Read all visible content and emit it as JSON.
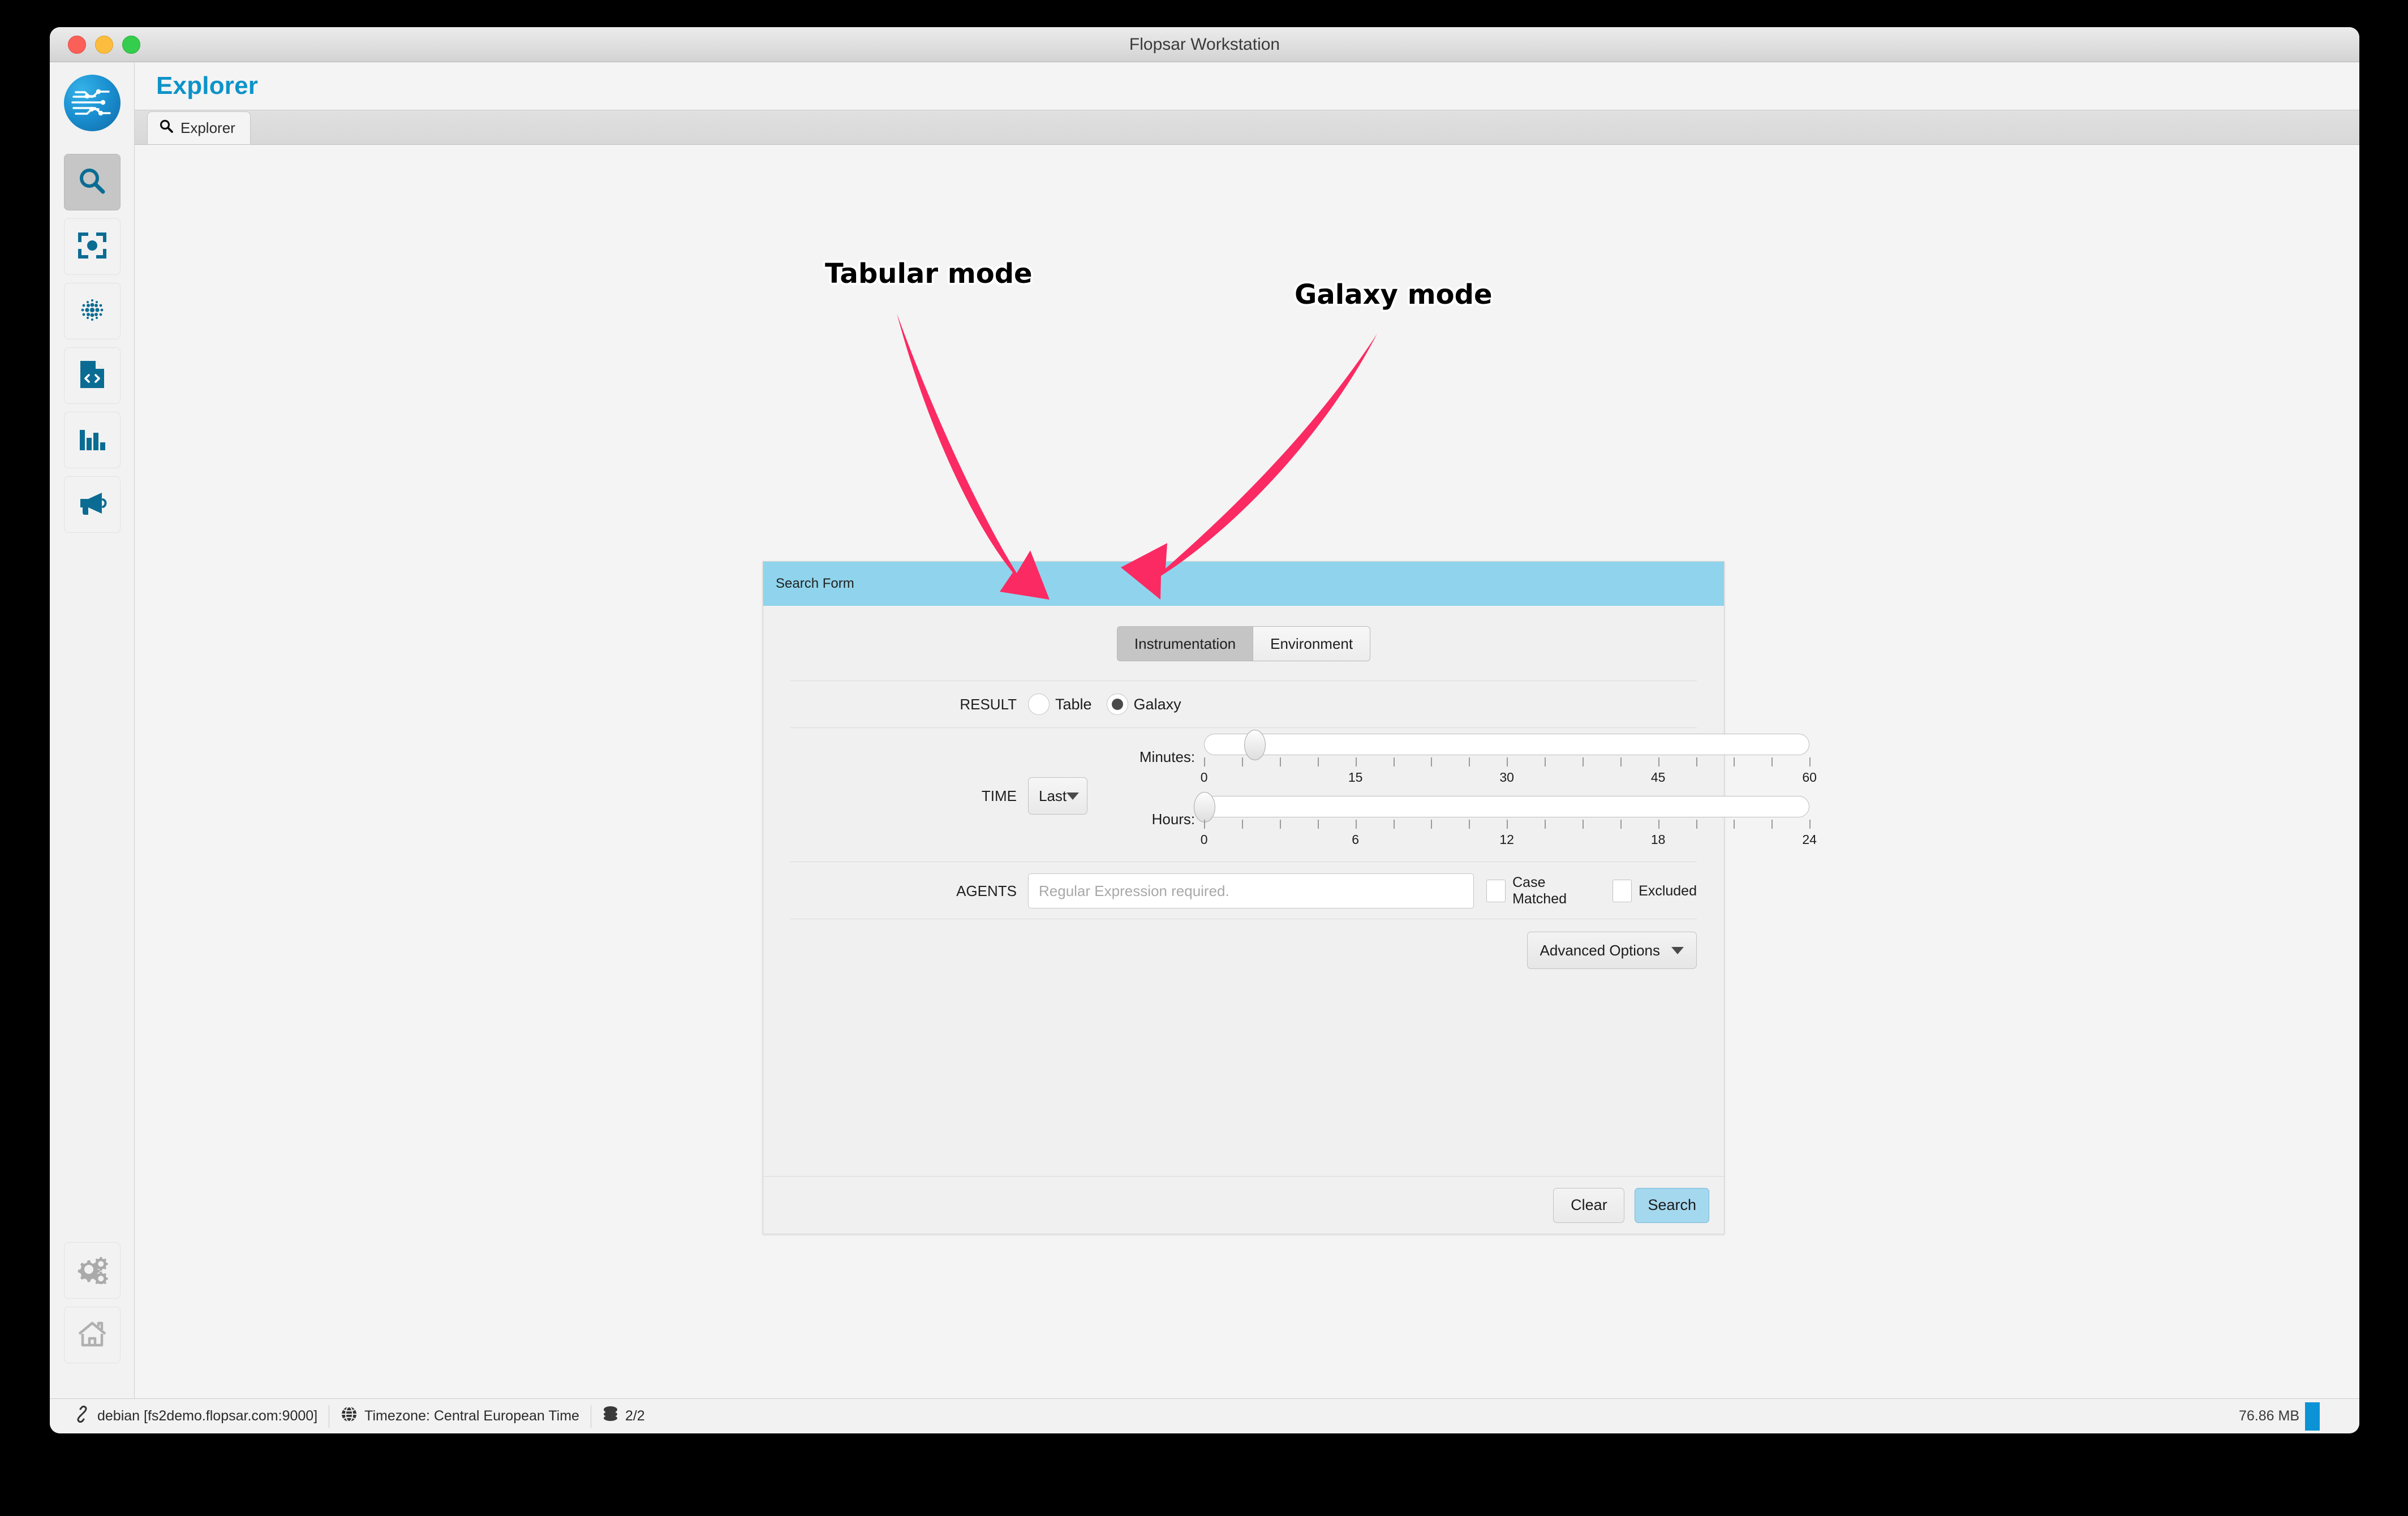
{
  "window": {
    "title": "Flopsar Workstation",
    "traffic_lights": [
      "close",
      "minimize",
      "zoom"
    ]
  },
  "page": {
    "title": "Explorer"
  },
  "tabs": [
    {
      "label": "Explorer",
      "icon": "search-icon",
      "active": true
    }
  ],
  "sidebar": {
    "logo": "flopsar-logo",
    "items": [
      {
        "icon": "search-icon",
        "active": true
      },
      {
        "icon": "target-focus-icon",
        "active": false
      },
      {
        "icon": "dot-grid-icon",
        "active": false
      },
      {
        "icon": "code-file-icon",
        "active": false
      },
      {
        "icon": "bar-chart-icon",
        "active": false
      },
      {
        "icon": "megaphone-icon",
        "active": false
      }
    ],
    "bottom_items": [
      {
        "icon": "gears-icon"
      },
      {
        "icon": "home-icon"
      }
    ]
  },
  "search_form": {
    "header_title": "Search Form",
    "mode_tabs": [
      {
        "label": "Instrumentation",
        "active": true
      },
      {
        "label": "Environment",
        "active": false
      }
    ],
    "result": {
      "label": "RESULT",
      "options": [
        {
          "label": "Table",
          "selected": false
        },
        {
          "label": "Galaxy",
          "selected": true
        }
      ]
    },
    "time": {
      "label": "TIME",
      "select_value": "Last",
      "minutes": {
        "label": "Minutes:",
        "value": 5,
        "min": 0,
        "max": 60,
        "tick_labels": [
          "0",
          "15",
          "30",
          "45",
          "60"
        ]
      },
      "hours": {
        "label": "Hours:",
        "value": 0,
        "min": 0,
        "max": 24,
        "tick_labels": [
          "0",
          "6",
          "12",
          "18",
          "24"
        ]
      }
    },
    "agents": {
      "label": "AGENTS",
      "value": "",
      "placeholder": "Regular Expression required.",
      "case_matched": {
        "label": "Case Matched",
        "checked": false
      },
      "excluded": {
        "label": "Excluded",
        "checked": false
      }
    },
    "advanced_options_label": "Advanced Options",
    "buttons": {
      "clear": "Clear",
      "search": "Search"
    }
  },
  "statusbar": {
    "connection": "debian [fs2demo.flopsar.com:9000]",
    "timezone": "Timezone: Central European Time",
    "nodes": "2/2",
    "memory": "76.86 MB"
  },
  "annotations": [
    {
      "text": "Tabular mode",
      "target": "table-radio"
    },
    {
      "text": "Galaxy mode",
      "target": "galaxy-radio"
    }
  ],
  "colors": {
    "accent_blue": "#0d93c9",
    "panel_header": "#8fd4ec",
    "primary_button": "#a4d8ef",
    "annotation_pink": "#fb2a63",
    "icon_teal": "#0b6c93",
    "memory_bar": "#0b93d5"
  }
}
